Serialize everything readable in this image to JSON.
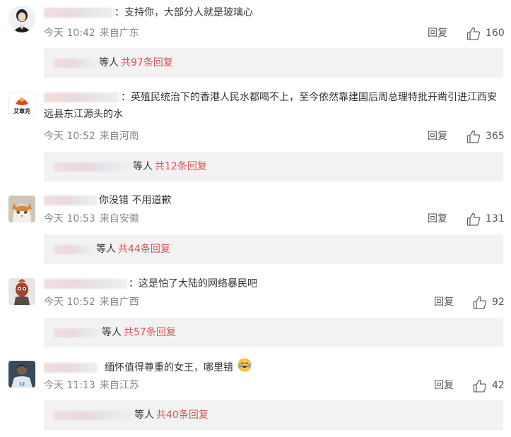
{
  "comments": [
    {
      "text": "：支持你，大部分人就是玻璃心",
      "time": "今天 10:42",
      "location": "来自广东",
      "reply_label": "回复",
      "likes": "160",
      "replies_by": "等人",
      "replies_count": "共97条回复"
    },
    {
      "text": "：英殖民统治下的香港人民水都喝不上，至今依然靠建国后周总理特批开凿引进江西安远县东江源头的水",
      "time": "今天 10:52",
      "location": "来自河南",
      "reply_label": "回复",
      "likes": "365",
      "avatar_text": "艾章克",
      "replies_by": "等人",
      "replies_count": "共12条回复"
    },
    {
      "text": "你没错 不用道歉",
      "time": "今天 10:53",
      "location": "来自安徽",
      "reply_label": "回复",
      "likes": "131",
      "replies_by": "等人",
      "replies_count": "共44条回复"
    },
    {
      "text": "：这是怕了大陆的网络暴民吧",
      "time": "今天 10:52",
      "location": "来自广西",
      "reply_label": "回复",
      "likes": "92",
      "replies_by": "等人",
      "replies_count": "共57条回复"
    },
    {
      "text": "缅怀值得尊重的女王，哪里错",
      "time": "今天 11:13",
      "location": "来自江苏",
      "reply_label": "回复",
      "likes": "42",
      "replies_by": "等人",
      "replies_count": "共40条回复"
    }
  ],
  "icons": {
    "like": "thumbs-up-icon",
    "emoji": "laughing-crying-emoji-icon"
  },
  "colors": {
    "reply_count": "#d8545a",
    "meta": "#888888",
    "reply_box": "#f2f2f2"
  }
}
